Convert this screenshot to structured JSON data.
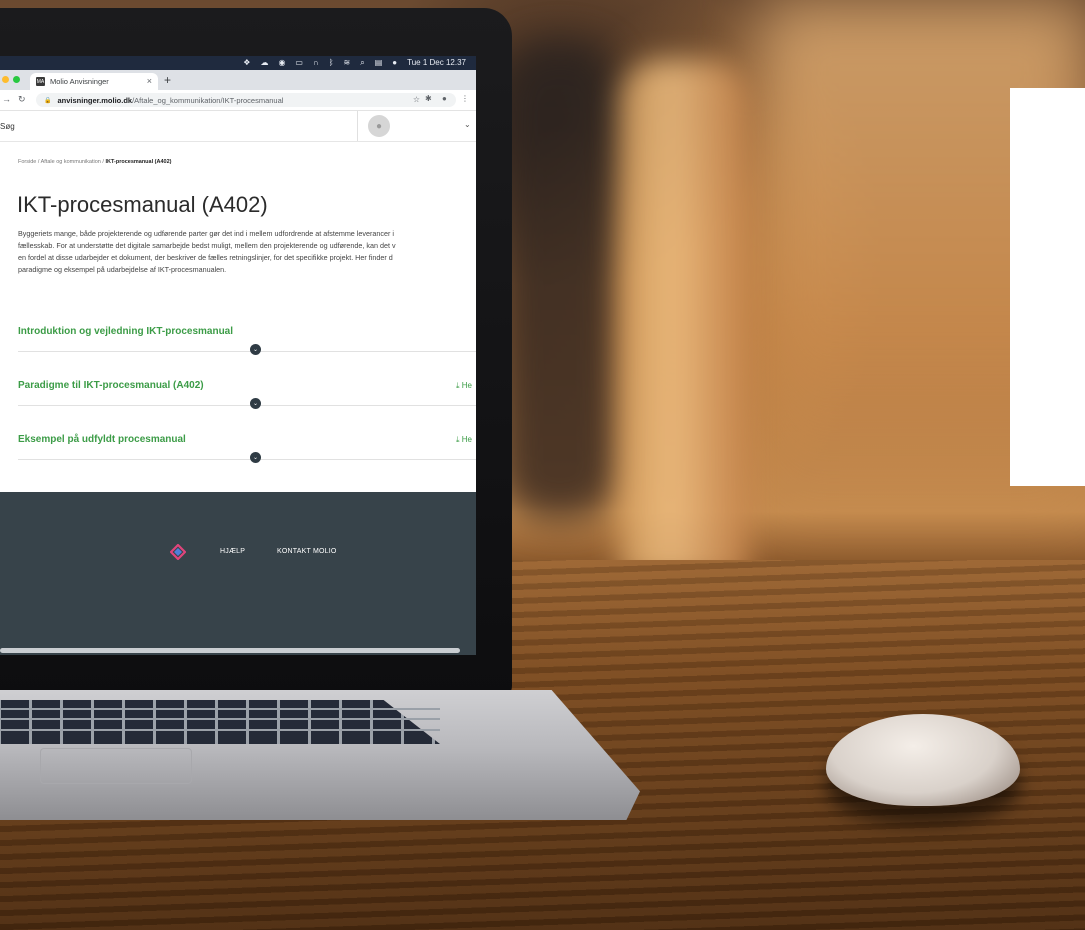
{
  "menubar": {
    "clock": "Tue 1 Dec 12.37",
    "icons": [
      "dropbox-icon",
      "cloud-icon",
      "record-icon",
      "battery-icon",
      "headphones-icon",
      "bluetooth-icon",
      "wifi-icon",
      "spotlight-icon",
      "control-center-icon",
      "siri-icon"
    ]
  },
  "browser": {
    "tab_title": "Molio Anvisninger",
    "tab_favicon": "MA",
    "url_domain": "anvisninger.molio.dk",
    "url_path": "/Aftale_og_kommunikation/IKT-procesmanual"
  },
  "site": {
    "search_label": "Søg"
  },
  "breadcrumb": {
    "items": [
      "Forside",
      "Aftale og kommunikation"
    ],
    "current": "IKT-procesmanual (A402)"
  },
  "page": {
    "title": "IKT-procesmanual (A402)",
    "intro_lines": [
      "Byggeriets mange, både projekterende og udførende parter gør det ind i mellem udfordrende at afstemme leverancer i",
      "fællesskab. For at understøtte det digitale samarbejde bedst muligt, mellem den projekterende og udførende, kan det v",
      "en fordel at disse udarbejder et dokument, der beskriver de fælles retningslinjer, for det specifikke projekt. Her finder d",
      "paradigme og eksempel på udarbejdelse af IKT-procesmanualen."
    ]
  },
  "accordions": [
    {
      "label": "Introduktion og vejledning IKT-procesmanual",
      "download": ""
    },
    {
      "label": "Paradigme til IKT-procesmanual (A402)",
      "download": "He"
    },
    {
      "label": "Eksempel på udfyldt procesmanual",
      "download": "He"
    }
  ],
  "footer": {
    "help": "HJÆLP",
    "contact": "KONTAKT MOLIO"
  },
  "colors": {
    "accent_green": "#3c9c47",
    "footer_bg": "#37434a",
    "menubar_bg": "#1f2a3e"
  }
}
